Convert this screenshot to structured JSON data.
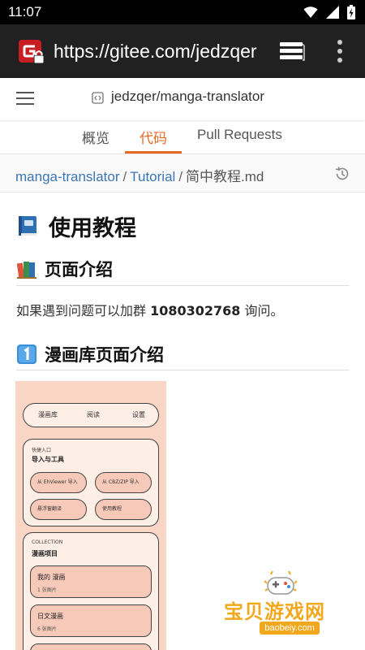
{
  "status_bar": {
    "time": "11:07",
    "icons": [
      "wifi-icon",
      "signal-icon",
      "battery-icon"
    ]
  },
  "browser": {
    "url": "https://gitee.com/jedzqer",
    "site_icon": "gitee-logo-lock-icon",
    "tabs_icon": "tabs-icon",
    "menu_icon": "overflow-menu-icon"
  },
  "repo_header": {
    "menu_icon": "hamburger-menu-icon",
    "repo_icon": "code-repo-icon",
    "repo_name": "jedzqer/manga-translator"
  },
  "tabs": [
    {
      "label": "概览",
      "active": false
    },
    {
      "label": "代码",
      "active": true
    },
    {
      "label": "Pull Requests",
      "active": false
    }
  ],
  "breadcrumb": {
    "items": [
      "manga-translator",
      "Tutorial"
    ],
    "separator": "/",
    "current": "简中教程.md",
    "history_icon": "history-icon"
  },
  "content": {
    "h1": {
      "emoji": "blue-book-icon",
      "text": "使用教程"
    },
    "section1": {
      "emoji": "books-icon",
      "text": "页面介绍"
    },
    "paragraph": {
      "before": "如果遇到问题可以加群 ",
      "bold": "1080302768",
      "after": " 询问。"
    },
    "section2": {
      "emoji": "keycap-1-icon",
      "text": "漫画库页面介绍"
    }
  },
  "mockup_image": {
    "nav": [
      "漫画库",
      "阅读",
      "设置"
    ],
    "quick_label": "快捷入口",
    "quick_title": "导入与工具",
    "buttons": [
      "从 EhViewer 导入",
      "从 CBZ/ZIP 导入",
      "悬浮窗翻译",
      "使用教程"
    ],
    "collection_label": "COLLECTION",
    "collection_title": "漫画项目",
    "items": [
      {
        "name": "我的 漫画",
        "count": "1 张图片"
      },
      {
        "name": "日文漫画",
        "count": "6 张图片"
      }
    ]
  },
  "watermark": {
    "text": "宝贝游戏网",
    "url": "baobeiy.com"
  },
  "colors": {
    "accent": "#e76a24",
    "link": "#3a76b5",
    "browser_bar": "#212121",
    "watermark": "#f2a81d"
  }
}
